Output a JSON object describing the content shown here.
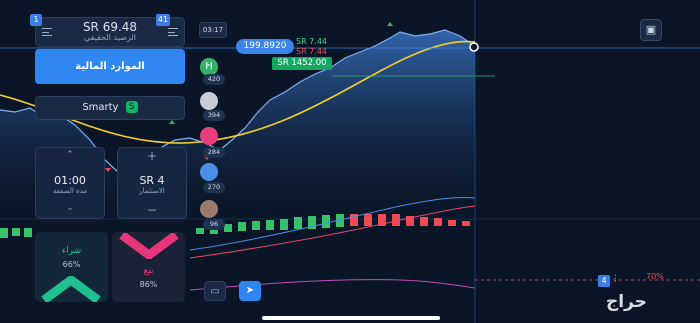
{
  "account": {
    "balance": "SR 69.48",
    "balance_label": "الرصيد الحقيقي",
    "badge_left": "1",
    "badge_right": "41"
  },
  "buttons": {
    "finance": "الموارد المالية",
    "smarty": "Smarty",
    "smarty_icon": "S"
  },
  "trade": {
    "duration_value": "01:00",
    "duration_label": "مدة الصفقة",
    "investment_value": "SR 4",
    "investment_label": "الاستثمار",
    "buy_label": "شراء",
    "buy_pct": "66%",
    "sell_label": "بيع",
    "sell_pct": "86%"
  },
  "chart": {
    "timeframe": "03:17",
    "price_tag": "199.8920",
    "green_tag": "SR 7.44",
    "red_tag": "SR 7.44",
    "amount_tag": "SR 1452.00",
    "indicator_level": "70%",
    "counter_badge": "4"
  },
  "traders": [
    {
      "initial": "H",
      "count": "420",
      "color": "#35b36b"
    },
    {
      "initial": "",
      "count": "394",
      "color": "#c9cdd3"
    },
    {
      "initial": "",
      "count": "284",
      "color": "#e83e7a"
    },
    {
      "initial": "",
      "count": "270",
      "color": "#4a8ee8"
    },
    {
      "initial": "",
      "count": "96",
      "color": "#9a7a6a"
    }
  ],
  "icons": {
    "menu": "menu-icon",
    "gift": "gift-icon",
    "chevron_up": "chevron-up-icon",
    "chevron_down": "chevron-down-icon",
    "plus": "plus-icon",
    "minus": "minus-icon",
    "send": "send-icon",
    "chart_type": "chart-type-icon"
  },
  "watermark": "حراج",
  "colors": {
    "accent": "#2f86f0",
    "buy": "#1fbf8f",
    "sell": "#e8367a",
    "up": "#35b36b",
    "down": "#ef4b55"
  }
}
